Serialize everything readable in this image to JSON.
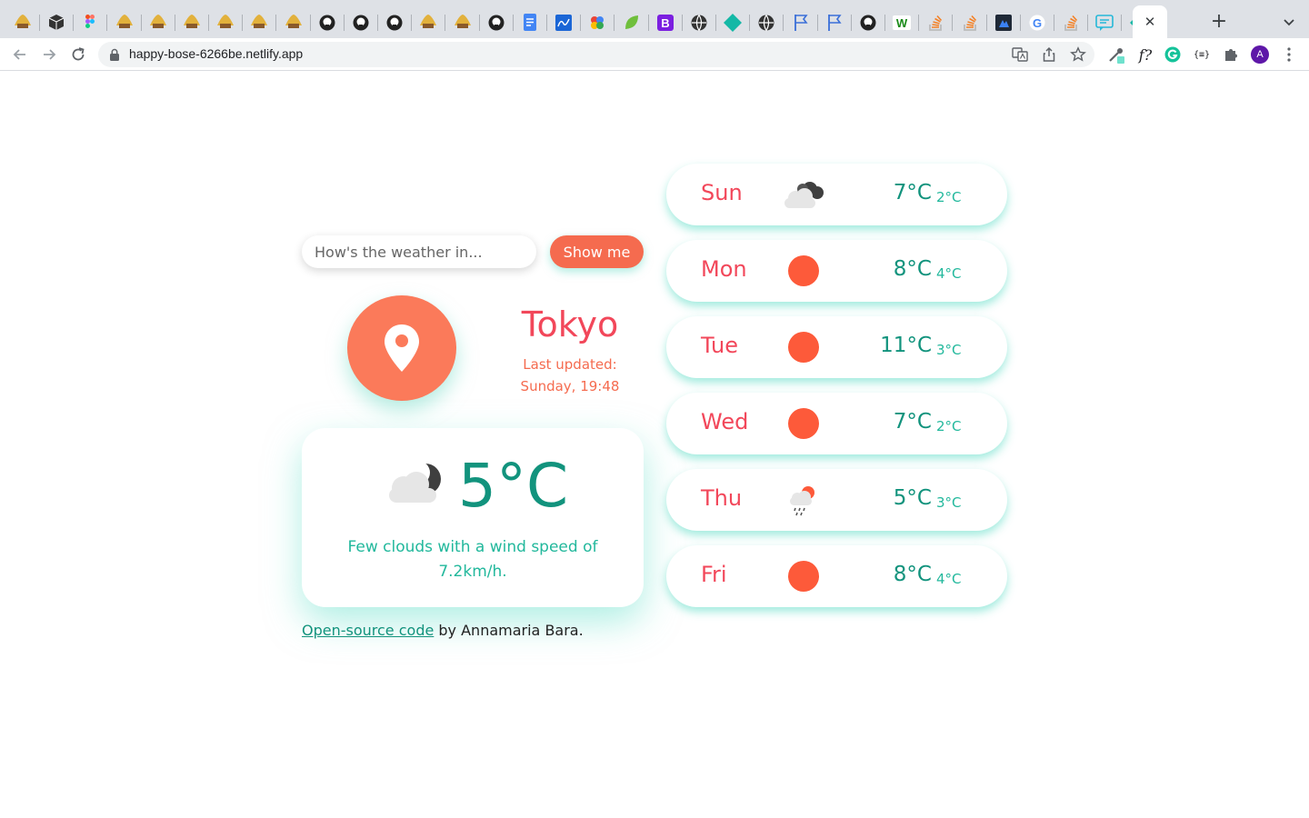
{
  "browser": {
    "url": "happy-bose-6266be.netlify.app",
    "tab_icons": [
      "netlify-icon",
      "cube-icon",
      "figma-icon",
      "netlify-icon",
      "netlify-icon",
      "netlify-icon",
      "netlify-icon",
      "netlify-icon",
      "netlify-icon",
      "github-icon",
      "github-icon",
      "github-icon",
      "netlify-icon",
      "netlify-icon",
      "github-icon",
      "docs-icon",
      "signature-icon",
      "colorful-icon",
      "leaf-icon",
      "bootstrap-icon",
      "globe-icon",
      "diamond-icon",
      "globe-icon",
      "flag-icon",
      "flag-icon",
      "github-icon",
      "wordpress-icon",
      "stackoverflow-icon",
      "stackoverflow-icon",
      "square-icon",
      "google-icon",
      "stackoverflow-icon",
      "chat-icon",
      "diamond-icon"
    ],
    "bootstrap_letter": "B",
    "google_letter": "G",
    "wordpress_letter": "W",
    "tab_close": "✕",
    "new_tab": "+",
    "avatar_letter": "A",
    "ext_formula": "f?",
    "ext_braces": "{≡}"
  },
  "app": {
    "search": {
      "placeholder": "How's the weather in..."
    },
    "search_button": "Show me",
    "city": "Tokyo",
    "last_updated_label": "Last updated:",
    "last_updated_value": "Sunday, 19:48",
    "current": {
      "temperature": "5°C",
      "description": "Few clouds with a wind speed of 7.2km/h.",
      "icon": "few-clouds-night-icon"
    },
    "footer": {
      "link": "Open-source code",
      "text": " by Annamaria Bara."
    },
    "forecast": [
      {
        "day": "Sun",
        "max": "7°C",
        "min": "2°C",
        "icon": "broken-clouds-icon"
      },
      {
        "day": "Mon",
        "max": "8°C",
        "min": "4°C",
        "icon": "sun-icon"
      },
      {
        "day": "Tue",
        "max": "11°C",
        "min": "3°C",
        "icon": "sun-icon"
      },
      {
        "day": "Wed",
        "max": "7°C",
        "min": "2°C",
        "icon": "sun-icon"
      },
      {
        "day": "Thu",
        "max": "5°C",
        "min": "3°C",
        "icon": "rain-icon"
      },
      {
        "day": "Fri",
        "max": "8°C",
        "min": "4°C",
        "icon": "sun-icon"
      }
    ]
  },
  "colors": {
    "accent_coral": "#f56b4f",
    "day_red": "#f2475a",
    "temp_teal": "#12937d",
    "shadow_mint": "#6fe1cd"
  }
}
